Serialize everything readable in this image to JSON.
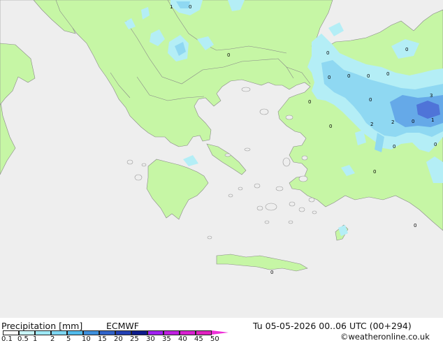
{
  "map": {
    "colors": {
      "sea": "#eeeeee",
      "land": "#c6f6a5",
      "border": "#888888",
      "precip_light": "#b4eef6",
      "precip_medium": "#8fd8f2",
      "precip_heavy": "#65a9e8",
      "precip_max": "#4f74d8"
    },
    "point_labels": [
      "1",
      "0",
      "0",
      "0",
      "0",
      "0",
      "0",
      "0",
      "0",
      "0",
      "0",
      "0",
      "3",
      "2",
      "2",
      "0",
      "1",
      "0",
      "0",
      "0",
      "0",
      "0"
    ]
  },
  "footer": {
    "title": "Precipitation [mm]",
    "model": "ECMWF",
    "datetime": "Tu 05-05-2026 00..06 UTC (00+294)",
    "credit": "©weatheronline.co.uk",
    "scale": {
      "ticks": [
        "0.1",
        "0.5",
        "1",
        "2",
        "5",
        "10",
        "15",
        "20",
        "25",
        "30",
        "35",
        "40",
        "45",
        "50"
      ],
      "colors": [
        "#ffffff",
        "#c8f4f8",
        "#9ee8f5",
        "#7dd6f2",
        "#52bbeb",
        "#3d8fdc",
        "#3063c9",
        "#2240b3",
        "#0d1b8c",
        "#a020f0",
        "#c020e0",
        "#d820d0",
        "#e020c0",
        "#ee30d8"
      ]
    }
  }
}
